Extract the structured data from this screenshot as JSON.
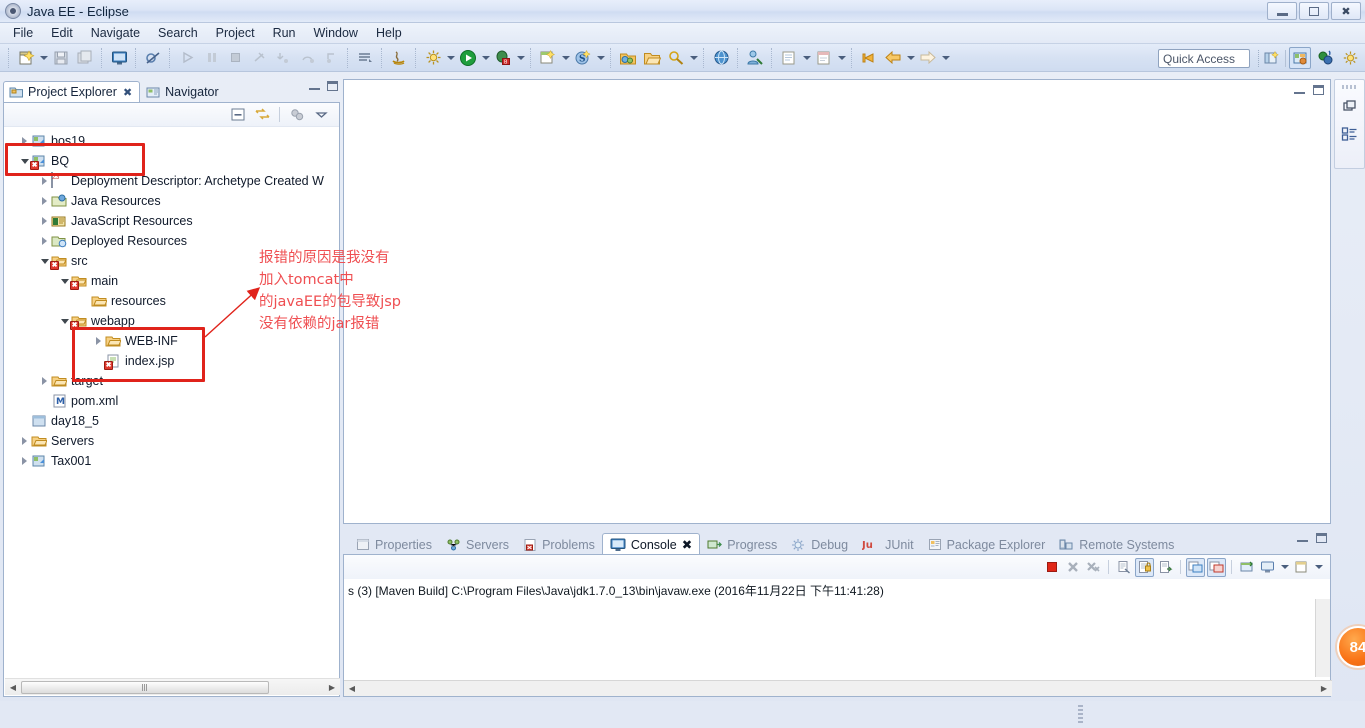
{
  "window": {
    "title": "Java EE - Eclipse",
    "app_icon": "eclipse-icon",
    "minimize_label": "Minimize",
    "restore_label": "Restore",
    "close_label": "Close"
  },
  "menubar": {
    "items": [
      {
        "label": "File"
      },
      {
        "label": "Edit"
      },
      {
        "label": "Navigate"
      },
      {
        "label": "Search"
      },
      {
        "label": "Project"
      },
      {
        "label": "Run"
      },
      {
        "label": "Window"
      },
      {
        "label": "Help"
      }
    ]
  },
  "toolbar": {
    "quick_access_placeholder": "Quick Access",
    "quick_access_value": "",
    "groups": [
      {
        "buttons": [
          {
            "name": "new-wizard-icon",
            "glyph": "new"
          },
          {
            "name": "new-dropdown-icon",
            "glyph": "arrow"
          },
          {
            "name": "save-icon",
            "glyph": "save"
          },
          {
            "name": "save-all-icon",
            "glyph": "saveall"
          },
          {
            "name": "open-console-icon",
            "glyph": "console"
          },
          {
            "name": "skip-breakpoints-icon",
            "glyph": "skip"
          }
        ]
      },
      {
        "buttons": [
          {
            "name": "resume-icon",
            "glyph": "resume"
          },
          {
            "name": "suspend-icon",
            "glyph": "suspend"
          },
          {
            "name": "terminate-icon",
            "glyph": "terminate"
          },
          {
            "name": "disconnect-icon",
            "glyph": "disconnect"
          },
          {
            "name": "step-into-icon",
            "glyph": "stepinto"
          },
          {
            "name": "step-over-icon",
            "glyph": "stepover"
          },
          {
            "name": "step-return-icon",
            "glyph": "stepreturn"
          }
        ]
      },
      {
        "buttons": [
          {
            "name": "build-all-icon",
            "glyph": "build"
          }
        ]
      },
      {
        "buttons": [
          {
            "name": "new-java-class-icon",
            "glyph": "javaclass"
          }
        ]
      },
      {
        "buttons": [
          {
            "name": "external-tools-icon",
            "glyph": "exttools"
          },
          {
            "name": "external-tools-dropdown-icon",
            "glyph": "arrow"
          },
          {
            "name": "run-icon",
            "glyph": "run"
          },
          {
            "name": "run-dropdown-icon",
            "glyph": "arrow"
          },
          {
            "name": "debug-icon",
            "glyph": "debug"
          },
          {
            "name": "debug-dropdown-icon",
            "glyph": "arrow"
          }
        ]
      },
      {
        "buttons": [
          {
            "name": "new-server-icon",
            "glyph": "server"
          },
          {
            "name": "new-server-dropdown-icon",
            "glyph": "arrow"
          },
          {
            "name": "new-spring-icon",
            "glyph": "spring"
          },
          {
            "name": "new-spring-dropdown-icon",
            "glyph": "arrow"
          }
        ]
      },
      {
        "buttons": [
          {
            "name": "open-type-icon",
            "glyph": "opentype"
          },
          {
            "name": "open-resource-icon",
            "glyph": "openres"
          },
          {
            "name": "search-icon",
            "glyph": "searchtool"
          },
          {
            "name": "search-dropdown-icon",
            "glyph": "arrow"
          }
        ]
      },
      {
        "buttons": [
          {
            "name": "web-browser-icon",
            "glyph": "globe"
          }
        ]
      },
      {
        "buttons": [
          {
            "name": "profile-icon",
            "glyph": "profile"
          }
        ]
      },
      {
        "buttons": [
          {
            "name": "new-jsp-icon",
            "glyph": "jsp"
          },
          {
            "name": "new-jsp-dropdown-icon",
            "glyph": "arrow"
          },
          {
            "name": "new-html-icon",
            "glyph": "html"
          },
          {
            "name": "new-html-dropdown-icon",
            "glyph": "arrow"
          }
        ]
      },
      {
        "buttons": [
          {
            "name": "previous-annotation-icon",
            "glyph": "prevann"
          },
          {
            "name": "back-icon",
            "glyph": "back"
          },
          {
            "name": "back-dropdown-icon",
            "glyph": "arrow"
          },
          {
            "name": "forward-icon",
            "glyph": "forward"
          },
          {
            "name": "forward-dropdown-icon",
            "glyph": "arrow"
          }
        ]
      }
    ],
    "perspective_buttons": [
      {
        "name": "open-perspective-icon",
        "glyph": "openpersp",
        "active": false
      },
      {
        "name": "perspective-java-ee-icon",
        "glyph": "javaee",
        "active": true
      },
      {
        "name": "perspective-java-icon",
        "glyph": "java",
        "active": false
      },
      {
        "name": "perspective-debug-icon",
        "glyph": "debugpersp",
        "active": false
      }
    ]
  },
  "left_view": {
    "tabs": [
      {
        "label": "Project Explorer",
        "icon": "project-explorer-icon",
        "active": true,
        "closable": true
      },
      {
        "label": "Navigator",
        "icon": "navigator-icon",
        "active": false,
        "closable": false
      }
    ],
    "view_toolbar": [
      {
        "name": "collapse-all-icon"
      },
      {
        "name": "link-with-editor-icon"
      },
      {
        "name": "focus-on-active-task-icon"
      },
      {
        "name": "view-menu-icon"
      }
    ],
    "minimize_label": "Minimize",
    "maximize_label": "Maximize",
    "tree": [
      {
        "label": "bos19",
        "icon": "project-icon",
        "indent": 0,
        "expander": "collapsed",
        "error": false
      },
      {
        "label": "BQ",
        "icon": "project-icon",
        "indent": 0,
        "expander": "expanded",
        "error": true,
        "highlighted": true
      },
      {
        "label": "Deployment Descriptor: Archetype Created W",
        "icon": "deployment-descriptor-icon",
        "indent": 1,
        "expander": "collapsed",
        "error": false
      },
      {
        "label": "Java Resources",
        "icon": "java-resources-icon",
        "indent": 1,
        "expander": "collapsed",
        "error": false
      },
      {
        "label": "JavaScript Resources",
        "icon": "javascript-resources-icon",
        "indent": 1,
        "expander": "collapsed",
        "error": false
      },
      {
        "label": "Deployed Resources",
        "icon": "deployed-resources-icon",
        "indent": 1,
        "expander": "collapsed",
        "error": false
      },
      {
        "label": "src",
        "icon": "source-folder-icon",
        "indent": 1,
        "expander": "expanded",
        "error": true
      },
      {
        "label": "main",
        "icon": "source-folder-icon",
        "indent": 2,
        "expander": "expanded",
        "error": true
      },
      {
        "label": "resources",
        "icon": "folder-icon",
        "indent": 3,
        "expander": "none",
        "error": false
      },
      {
        "label": "webapp",
        "icon": "source-folder-icon",
        "indent": 3,
        "expander": "expanded",
        "error": true
      },
      {
        "label": "WEB-INF",
        "icon": "folder-icon",
        "indent": 4,
        "expander": "collapsed",
        "error": false
      },
      {
        "label": "index.jsp",
        "icon": "jsp-file-icon",
        "indent": 4,
        "expander": "none",
        "error": true
      },
      {
        "label": "target",
        "icon": "folder-icon",
        "indent": 1,
        "expander": "collapsed",
        "error": false
      },
      {
        "label": "pom.xml",
        "icon": "maven-pom-icon",
        "indent": 1,
        "expander": "none",
        "error": false
      },
      {
        "label": "day18_5",
        "icon": "closed-project-icon",
        "indent": 0,
        "expander": "none",
        "error": false
      },
      {
        "label": "Servers",
        "icon": "folder-icon",
        "indent": 0,
        "expander": "collapsed",
        "error": false
      },
      {
        "label": "Tax001",
        "icon": "project-icon",
        "indent": 0,
        "expander": "collapsed",
        "error": false
      }
    ]
  },
  "annotation": {
    "color": "#ef4f52",
    "box_color": "#e0231b",
    "lines": [
      "报错的原因是我没有",
      "加入tomcat中",
      "的javaEE的包导致jsp",
      "没有依赖的jar报错"
    ],
    "boxes": [
      {
        "name": "highlight-box-project-bq"
      },
      {
        "name": "highlight-box-webapp-contents"
      }
    ],
    "arrow_name": "annotation-arrow"
  },
  "editor": {
    "minimize_label": "Minimize",
    "maximize_label": "Restore"
  },
  "console_view": {
    "tabs": [
      {
        "label": "Properties",
        "icon": "properties-icon",
        "active": false,
        "closable": false
      },
      {
        "label": "Servers",
        "icon": "servers-icon",
        "active": false,
        "closable": false
      },
      {
        "label": "Problems",
        "icon": "problems-icon",
        "active": false,
        "closable": false
      },
      {
        "label": "Console",
        "icon": "console-icon",
        "active": true,
        "closable": true
      },
      {
        "label": "Progress",
        "icon": "progress-icon",
        "active": false,
        "closable": false
      },
      {
        "label": "Debug",
        "icon": "debug-icon",
        "active": false,
        "closable": false
      },
      {
        "label": "JUnit",
        "icon": "junit-icon",
        "active": false,
        "closable": false
      },
      {
        "label": "Package Explorer",
        "icon": "package-explorer-icon",
        "active": false,
        "closable": false
      },
      {
        "label": "Remote Systems",
        "icon": "remote-systems-icon",
        "active": false,
        "closable": false
      }
    ],
    "toolbar": [
      {
        "name": "terminate-icon",
        "framed": false
      },
      {
        "name": "remove-launch-icon",
        "framed": false
      },
      {
        "name": "remove-all-terminated-icon",
        "framed": false
      },
      {
        "name": "clear-console-icon",
        "framed": false
      },
      {
        "name": "scroll-lock-icon",
        "framed": true
      },
      {
        "name": "word-wrap-icon",
        "framed": false
      },
      {
        "name": "show-console-on-output-icon",
        "framed": true
      },
      {
        "name": "show-console-on-error-icon",
        "framed": true
      },
      {
        "name": "pin-console-icon",
        "framed": false
      },
      {
        "name": "display-selected-console-icon",
        "framed": false
      },
      {
        "name": "display-selected-console-dropdown-icon",
        "framed": false
      },
      {
        "name": "open-console-icon",
        "framed": false
      },
      {
        "name": "open-console-dropdown-icon",
        "framed": false
      }
    ],
    "output_line": "s (3) [Maven Build] C:\\Program Files\\Java\\jdk1.7.0_13\\bin\\javaw.exe (2016年11月22日 下午11:41:28)",
    "minimize_label": "Minimize",
    "maximize_label": "Maximize"
  },
  "fastview": {
    "buttons": [
      {
        "name": "restore-view-icon"
      },
      {
        "name": "outline-view-icon"
      }
    ]
  },
  "notification": {
    "badge_value": "84",
    "color": "#f97316"
  }
}
